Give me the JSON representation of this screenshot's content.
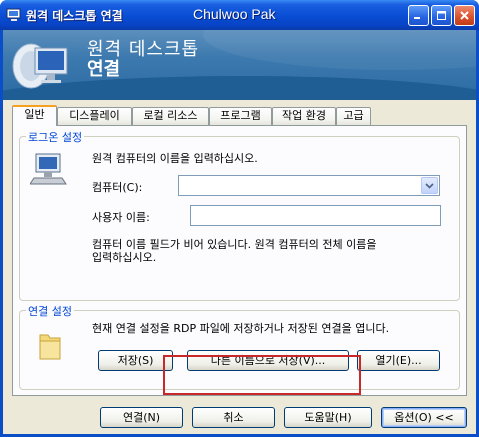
{
  "window": {
    "title": "원격 데스크톱 연결",
    "user": "Chulwoo Pak"
  },
  "banner": {
    "line1": "원격 데스크톱",
    "line2": "연결"
  },
  "tabs": [
    {
      "label": "일반"
    },
    {
      "label": "디스플레이"
    },
    {
      "label": "로컬 리소스"
    },
    {
      "label": "프로그램"
    },
    {
      "label": "작업 환경"
    },
    {
      "label": "고급"
    }
  ],
  "logon": {
    "group_label": "로그온 설정",
    "instruction": "원격 컴퓨터의 이름을 입력하십시오.",
    "computer_label": "컴퓨터(C):",
    "computer_value": "",
    "username_label": "사용자 이름:",
    "username_value": "",
    "note_line1": "컴퓨터 이름 필드가 비어 있습니다. 원격 컴퓨터의 전체 이름을",
    "note_line2": "입력하십시오."
  },
  "connection": {
    "group_label": "연결 설정",
    "description": "현재 연결 설정을 RDP 파일에 저장하거나 저장된 연결을 엽니다.",
    "save_label": "저장(S)",
    "save_as_label": "다른 이름으로 저장(V)...",
    "open_label": "열기(E)..."
  },
  "footer": {
    "connect_label": "연결(N)",
    "cancel_label": "취소",
    "help_label": "도움말(H)",
    "options_label": "옵션(O) <<"
  },
  "colors": {
    "titlebar": "#0a4fd6",
    "group_label": "#0046d5",
    "highlight": "#c8282a",
    "active_tab_accent": "#f6a021"
  }
}
